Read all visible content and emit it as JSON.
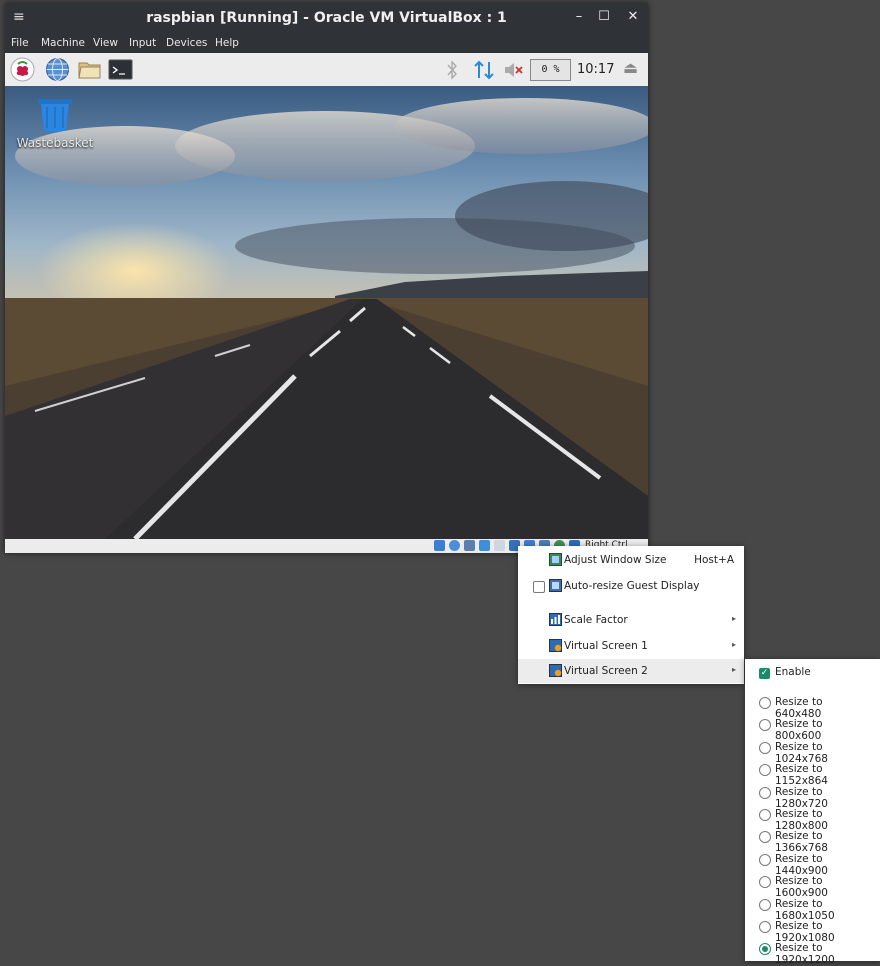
{
  "window": {
    "title": "raspbian [Running] - Oracle VM VirtualBox : 1",
    "menu_icon": "≡",
    "minimize": "–",
    "maximize": "☐",
    "close": "✕"
  },
  "menubar": {
    "items": [
      {
        "label": "File"
      },
      {
        "label": "Machine"
      },
      {
        "label": "View"
      },
      {
        "label": "Input"
      },
      {
        "label": "Devices"
      },
      {
        "label": "Help"
      }
    ]
  },
  "toolbar": {
    "launchers": [
      "raspberry-icon",
      "globe-icon",
      "folder-icon",
      "terminal-icon"
    ],
    "cpu": "0 %",
    "time": "10:17",
    "eject_icon": "⏏"
  },
  "desktop": {
    "icon_label": "Wastebasket"
  },
  "statusbar": {
    "host_key": "Right Ctrl"
  },
  "context_menu": {
    "items": [
      {
        "label": "Adjust Window Size",
        "shortcut": "Host+A"
      },
      {
        "label": "Auto-resize Guest Display"
      },
      {
        "label": "Scale Factor"
      },
      {
        "label": "Virtual Screen 1"
      },
      {
        "label": "Virtual Screen 2"
      }
    ],
    "arrow": "▸"
  },
  "submenu": {
    "enable_label": "Enable",
    "check": "✓",
    "resolutions": [
      "Resize to 640x480",
      "Resize to 800x600",
      "Resize to 1024x768",
      "Resize to 1152x864",
      "Resize to 1280x720",
      "Resize to 1280x800",
      "Resize to 1366x768",
      "Resize to 1440x900",
      "Resize to 1600x900",
      "Resize to 1680x1050",
      "Resize to 1920x1080",
      "Resize to 1920x1200"
    ],
    "selected_resolution": "Resize to 1920x1200"
  },
  "colors": {
    "accent": "#1b8a6a",
    "title_bar": "#2f3337",
    "screen_background": "#474747"
  }
}
